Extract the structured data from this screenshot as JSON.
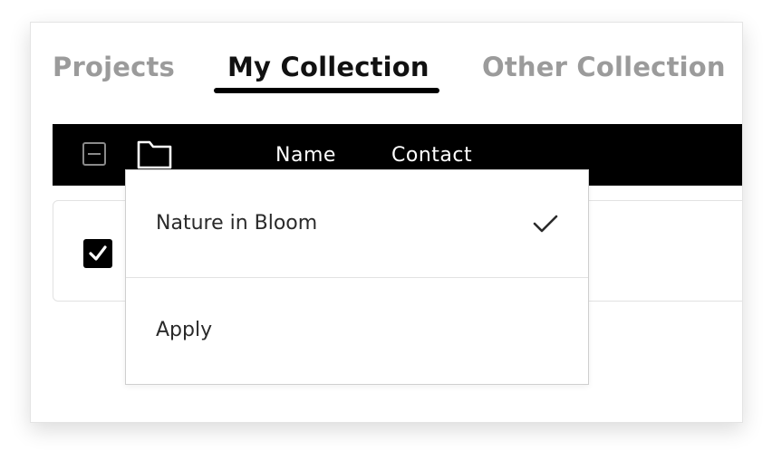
{
  "tabs": [
    {
      "label": "Projects",
      "active": false
    },
    {
      "label": "My Collection",
      "active": true
    },
    {
      "label": "Other Collection",
      "active": false
    }
  ],
  "table_header": {
    "columns": [
      "Name",
      "Contact"
    ],
    "select_all_state": "indeterminate"
  },
  "rows": [
    {
      "checked": true
    }
  ],
  "dropdown": {
    "options": [
      {
        "label": "Nature in Bloom",
        "selected": true
      }
    ],
    "apply_label": "Apply"
  },
  "colors": {
    "active_tab": "#111111",
    "inactive_tab": "#9b9b9b",
    "header_bg": "#000000",
    "header_text": "#ffffff"
  }
}
